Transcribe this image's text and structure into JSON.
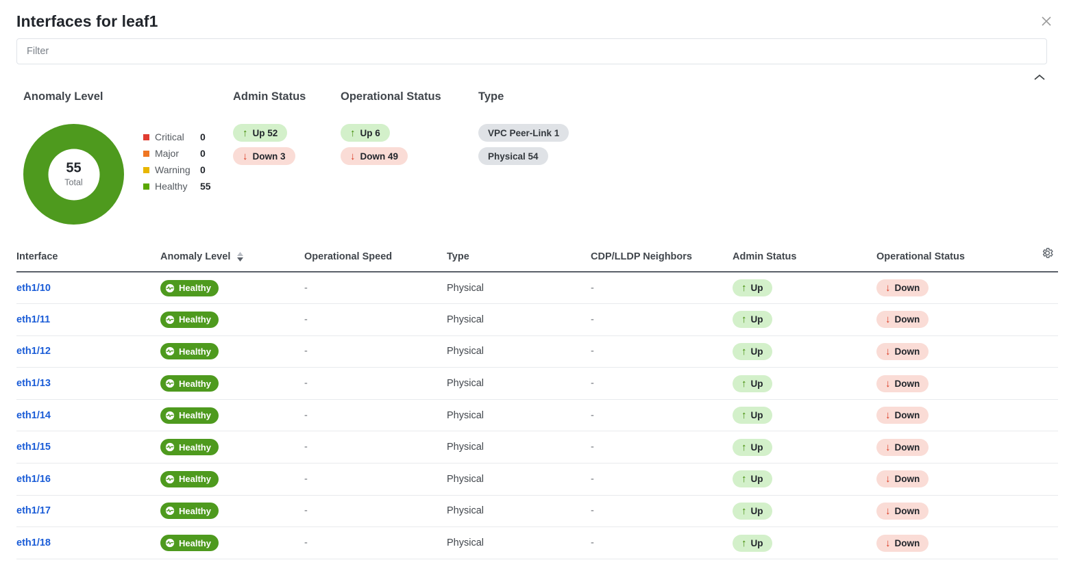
{
  "header": {
    "title": "Interfaces for leaf1",
    "close_icon": "close-icon"
  },
  "filter": {
    "placeholder": "Filter",
    "value": ""
  },
  "collapse": {
    "icon": "chevron-up-icon"
  },
  "summary": {
    "anomaly": {
      "title": "Anomaly Level",
      "total_value": "55",
      "total_label": "Total",
      "donut_color": "#4e9a1e",
      "legend": [
        {
          "name": "Critical",
          "value": "0",
          "color": "#e03c31"
        },
        {
          "name": "Major",
          "value": "0",
          "color": "#ef7622"
        },
        {
          "name": "Warning",
          "value": "0",
          "color": "#e8b600"
        },
        {
          "name": "Healthy",
          "value": "55",
          "color": "#5aa700"
        }
      ]
    },
    "admin_status": {
      "title": "Admin Status",
      "up_label": "Up 52",
      "down_label": "Down 3",
      "up_arrow": "arrow-up-icon",
      "down_arrow": "arrow-down-icon"
    },
    "operational_status": {
      "title": "Operational Status",
      "up_label": "Up 6",
      "down_label": "Down 49",
      "up_arrow": "arrow-up-icon",
      "down_arrow": "arrow-down-icon"
    },
    "type": {
      "title": "Type",
      "badges": [
        "VPC Peer-Link 1",
        "Physical 54"
      ]
    }
  },
  "table": {
    "columns": [
      "Interface",
      "Anomaly Level",
      "Operational Speed",
      "Type",
      "CDP/LLDP Neighbors",
      "Admin Status",
      "Operational Status"
    ],
    "sort_column": "Anomaly Level",
    "settings_icon": "gear-icon",
    "rows": [
      {
        "interface": "eth1/10",
        "anomaly": "Healthy",
        "speed": "-",
        "type": "Physical",
        "neighbors": "-",
        "admin": "Up",
        "operational": "Down"
      },
      {
        "interface": "eth1/11",
        "anomaly": "Healthy",
        "speed": "-",
        "type": "Physical",
        "neighbors": "-",
        "admin": "Up",
        "operational": "Down"
      },
      {
        "interface": "eth1/12",
        "anomaly": "Healthy",
        "speed": "-",
        "type": "Physical",
        "neighbors": "-",
        "admin": "Up",
        "operational": "Down"
      },
      {
        "interface": "eth1/13",
        "anomaly": "Healthy",
        "speed": "-",
        "type": "Physical",
        "neighbors": "-",
        "admin": "Up",
        "operational": "Down"
      },
      {
        "interface": "eth1/14",
        "anomaly": "Healthy",
        "speed": "-",
        "type": "Physical",
        "neighbors": "-",
        "admin": "Up",
        "operational": "Down"
      },
      {
        "interface": "eth1/15",
        "anomaly": "Healthy",
        "speed": "-",
        "type": "Physical",
        "neighbors": "-",
        "admin": "Up",
        "operational": "Down"
      },
      {
        "interface": "eth1/16",
        "anomaly": "Healthy",
        "speed": "-",
        "type": "Physical",
        "neighbors": "-",
        "admin": "Up",
        "operational": "Down"
      },
      {
        "interface": "eth1/17",
        "anomaly": "Healthy",
        "speed": "-",
        "type": "Physical",
        "neighbors": "-",
        "admin": "Up",
        "operational": "Down"
      },
      {
        "interface": "eth1/18",
        "anomaly": "Healthy",
        "speed": "-",
        "type": "Physical",
        "neighbors": "-",
        "admin": "Up",
        "operational": "Down"
      }
    ]
  }
}
